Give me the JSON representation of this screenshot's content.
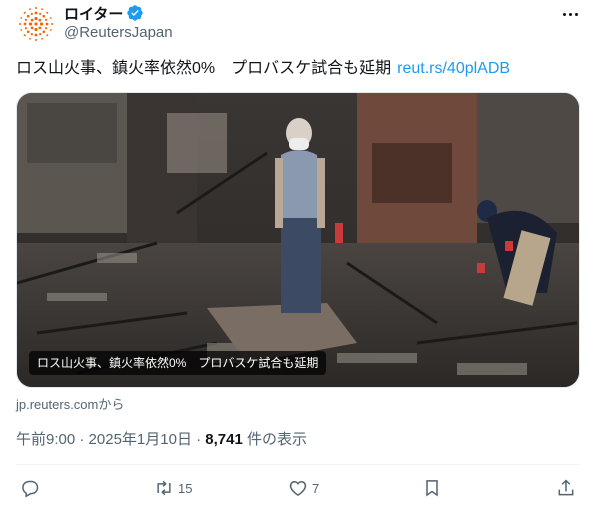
{
  "account": {
    "display_name": "ロイター",
    "handle": "@ReutersJapan",
    "verified": true,
    "avatar_icon": "reuters-logo-icon",
    "brand_color": "#fa6400"
  },
  "post": {
    "text": "ロス山火事、鎮火率依然0%　プロバスケ試合も延期",
    "link": "reut.rs/40plADB",
    "link_color": "#1d9bf0"
  },
  "card": {
    "caption": "ロス山火事、鎮火率依然0%　プロバスケ試合も延期",
    "source": "jp.reuters.comから",
    "image_icon": "burned-house-photo"
  },
  "meta": {
    "time": "午前9:00",
    "separator1": " · ",
    "date": "2025年1月10日",
    "separator2": " · ",
    "views": "8,741",
    "views_label": " 件の表示"
  },
  "actions": {
    "reply_count": "",
    "repost_count": "15",
    "like_count": "7"
  },
  "colors": {
    "secondary_text": "#536471",
    "primary_text": "#0f1419",
    "verified_badge": "#1d9bf0"
  }
}
